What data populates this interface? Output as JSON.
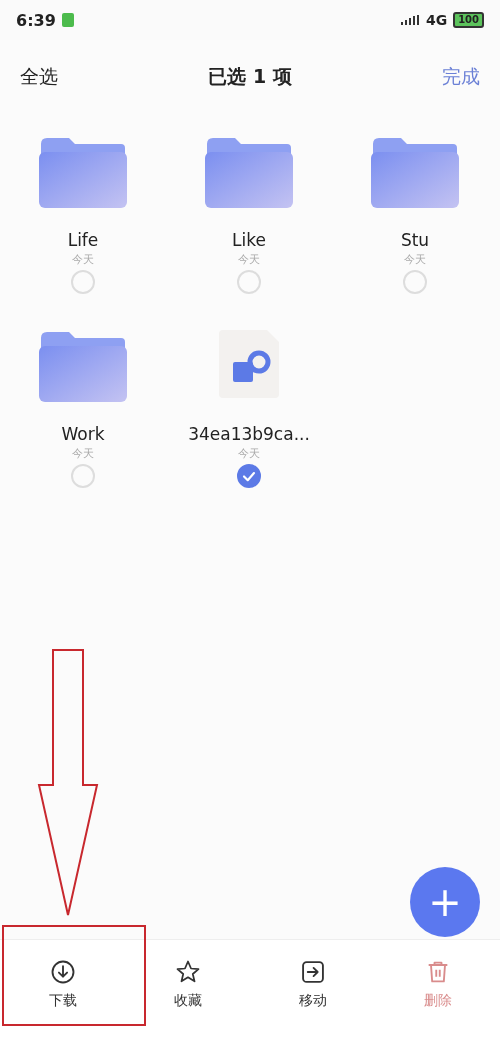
{
  "status_bar": {
    "time": "6:39",
    "network": "4G",
    "battery": "100"
  },
  "header": {
    "select_all": "全选",
    "title": "已选 1 项",
    "done": "完成"
  },
  "items": [
    {
      "kind": "folder",
      "name": "Life",
      "date": "今天",
      "selected": false
    },
    {
      "kind": "folder",
      "name": "Like",
      "date": "今天",
      "selected": false
    },
    {
      "kind": "folder",
      "name": "Stu",
      "date": "今天",
      "selected": false
    },
    {
      "kind": "folder",
      "name": "Work",
      "date": "今天",
      "selected": false
    },
    {
      "kind": "file",
      "name": "34ea13b9ca...",
      "date": "今天",
      "selected": true
    }
  ],
  "fab": {
    "label": "+"
  },
  "actions": [
    {
      "kind": "download",
      "label": "下载",
      "highlighted": true
    },
    {
      "kind": "favorite",
      "label": "收藏",
      "highlighted": false
    },
    {
      "kind": "move",
      "label": "移动",
      "highlighted": false
    },
    {
      "kind": "delete",
      "label": "删除",
      "highlighted": false
    }
  ]
}
